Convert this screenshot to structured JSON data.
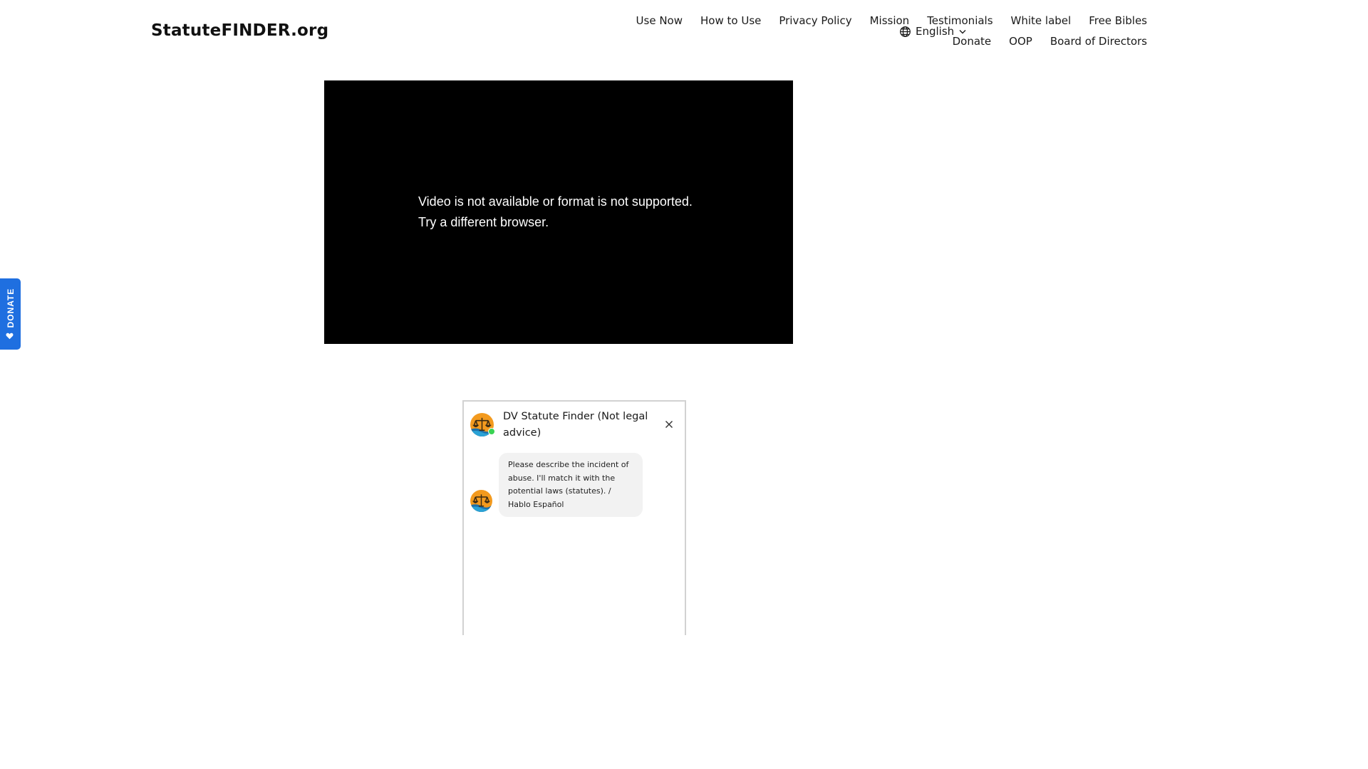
{
  "header": {
    "logo": "StatuteFINDER.org",
    "nav_row1": [
      "Use Now",
      "How to Use",
      "Privacy Policy",
      "Mission",
      "Testimonials",
      "White label",
      "Free Bibles"
    ],
    "nav_row2": [
      "Donate",
      "OOP",
      "Board of Directors"
    ],
    "language": "English"
  },
  "video": {
    "message_line1": "Video is not available or format is not supported.",
    "message_line2": "Try a different browser."
  },
  "donate_tab": {
    "label": "DONATE",
    "color": "#1f6fe0"
  },
  "chat": {
    "title": "DV Statute Finder (Not legal advice)",
    "status": "online",
    "status_color": "#39d353",
    "messages": [
      {
        "from": "bot",
        "text": "Please describe the incident of abuse. I'll match it with the potential laws (statutes). / Hablo Español"
      }
    ]
  }
}
